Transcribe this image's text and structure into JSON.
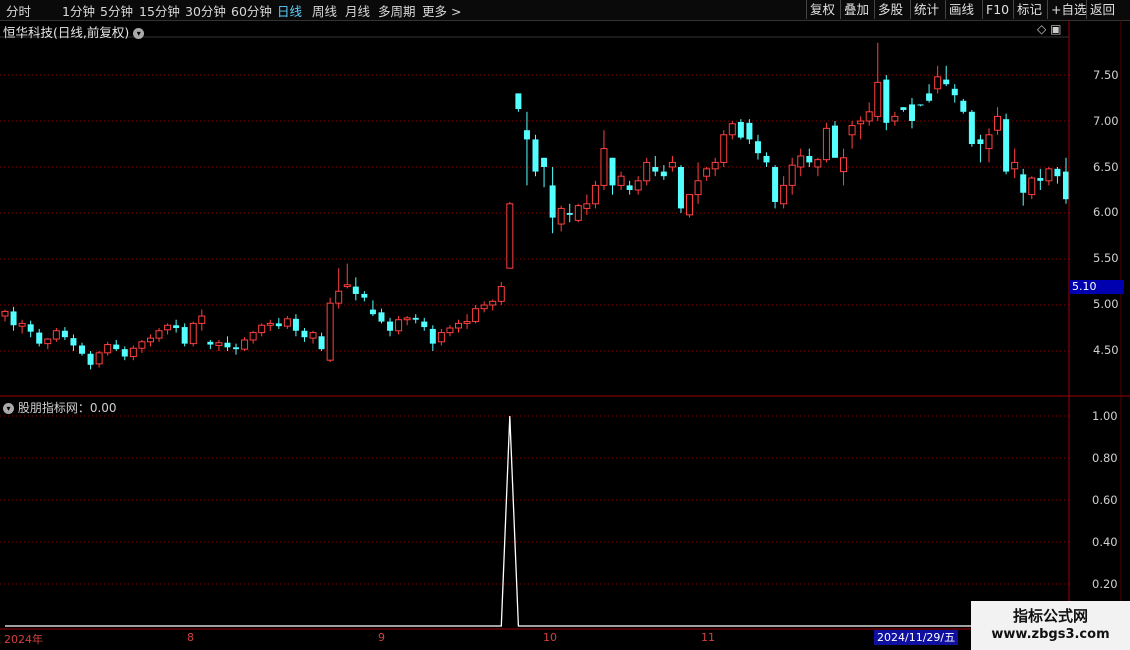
{
  "toolbar": {
    "timeframes": [
      "分时",
      "1分钟",
      "5分钟",
      "15分钟",
      "30分钟",
      "60分钟",
      "日线",
      "周线",
      "月线",
      "多周期",
      "更多 >"
    ],
    "active": "日线",
    "right_buttons": [
      "复权",
      "叠加",
      "多股",
      "统计",
      "画线",
      "F10",
      "标记",
      "+自选",
      "返回"
    ]
  },
  "stock_title": "恒华科技(日线,前复权)",
  "indicator_title": "股朋指标网：0.00",
  "current_price_box": "5.10",
  "price_axis": {
    "labels": [
      "7.50",
      "7.00",
      "6.50",
      "6.00",
      "5.50",
      "5.00",
      "4.50"
    ],
    "min": 4.1,
    "max": 7.95
  },
  "indicator_axis": {
    "labels": [
      "1.00",
      "0.80",
      "0.60",
      "0.40",
      "0.20"
    ]
  },
  "x_axis": {
    "labels": [
      "2024年",
      "8",
      "9",
      "10",
      "11"
    ],
    "cursor_date": "2024/11/29/五"
  },
  "watermark": {
    "line1": "指标公式网",
    "line2": "www.zbgs3.com"
  },
  "colors": {
    "up": "#ff4040",
    "down": "#54ffff",
    "grid": "#8b0000",
    "indicator_line": "#ffffff"
  },
  "chart_data": {
    "type": "candlestick",
    "candles": [
      [
        4.88,
        4.95,
        4.82,
        4.93
      ],
      [
        4.93,
        4.98,
        4.72,
        4.78
      ],
      [
        4.77,
        4.84,
        4.69,
        4.8
      ],
      [
        4.79,
        4.83,
        4.65,
        4.71
      ],
      [
        4.7,
        4.74,
        4.55,
        4.58
      ],
      [
        4.58,
        4.64,
        4.52,
        4.63
      ],
      [
        4.63,
        4.75,
        4.6,
        4.72
      ],
      [
        4.72,
        4.76,
        4.62,
        4.65
      ],
      [
        4.64,
        4.68,
        4.5,
        4.56
      ],
      [
        4.56,
        4.59,
        4.45,
        4.47
      ],
      [
        4.47,
        4.5,
        4.3,
        4.35
      ],
      [
        4.36,
        4.5,
        4.32,
        4.48
      ],
      [
        4.48,
        4.6,
        4.45,
        4.57
      ],
      [
        4.57,
        4.62,
        4.5,
        4.52
      ],
      [
        4.52,
        4.55,
        4.4,
        4.44
      ],
      [
        4.44,
        4.56,
        4.4,
        4.53
      ],
      [
        4.53,
        4.62,
        4.48,
        4.6
      ],
      [
        4.6,
        4.68,
        4.55,
        4.64
      ],
      [
        4.64,
        4.75,
        4.6,
        4.72
      ],
      [
        4.73,
        4.8,
        4.68,
        4.78
      ],
      [
        4.78,
        4.84,
        4.7,
        4.75
      ],
      [
        4.76,
        4.8,
        4.55,
        4.58
      ],
      [
        4.58,
        4.82,
        4.55,
        4.8
      ],
      [
        4.8,
        4.95,
        4.72,
        4.88
      ],
      [
        4.6,
        4.62,
        4.52,
        4.57
      ],
      [
        4.56,
        4.62,
        4.5,
        4.59
      ],
      [
        4.59,
        4.66,
        4.5,
        4.54
      ],
      [
        4.54,
        4.58,
        4.46,
        4.52
      ],
      [
        4.52,
        4.65,
        4.5,
        4.62
      ],
      [
        4.62,
        4.72,
        4.58,
        4.7
      ],
      [
        4.7,
        4.8,
        4.66,
        4.78
      ],
      [
        4.78,
        4.84,
        4.72,
        4.8
      ],
      [
        4.8,
        4.86,
        4.74,
        4.77
      ],
      [
        4.77,
        4.88,
        4.74,
        4.85
      ],
      [
        4.85,
        4.9,
        4.66,
        4.72
      ],
      [
        4.72,
        4.75,
        4.6,
        4.65
      ],
      [
        4.64,
        4.72,
        4.58,
        4.7
      ],
      [
        4.66,
        4.7,
        4.5,
        4.52
      ],
      [
        4.4,
        5.08,
        4.38,
        5.02
      ],
      [
        5.02,
        5.4,
        4.96,
        5.15
      ],
      [
        5.2,
        5.45,
        5.18,
        5.22
      ],
      [
        5.2,
        5.3,
        5.05,
        5.12
      ],
      [
        5.12,
        5.15,
        5.04,
        5.08
      ],
      [
        4.95,
        5.05,
        4.88,
        4.9
      ],
      [
        4.92,
        4.96,
        4.8,
        4.82
      ],
      [
        4.82,
        4.86,
        4.66,
        4.72
      ],
      [
        4.72,
        4.88,
        4.68,
        4.84
      ],
      [
        4.84,
        4.88,
        4.78,
        4.86
      ],
      [
        4.86,
        4.9,
        4.8,
        4.84
      ],
      [
        4.82,
        4.86,
        4.72,
        4.76
      ],
      [
        4.74,
        4.78,
        4.5,
        4.58
      ],
      [
        4.6,
        4.74,
        4.56,
        4.7
      ],
      [
        4.7,
        4.78,
        4.66,
        4.75
      ],
      [
        4.75,
        4.84,
        4.7,
        4.8
      ],
      [
        4.8,
        4.9,
        4.74,
        4.82
      ],
      [
        4.82,
        5.0,
        4.8,
        4.96
      ],
      [
        4.96,
        5.04,
        4.92,
        5.0
      ],
      [
        5.0,
        5.06,
        4.94,
        5.04
      ],
      [
        5.04,
        5.25,
        5.0,
        5.2
      ],
      [
        5.4,
        6.12,
        5.4,
        6.1
      ],
      [
        7.3,
        7.3,
        7.1,
        7.13
      ],
      [
        6.9,
        7.1,
        6.3,
        6.8
      ],
      [
        6.8,
        6.85,
        6.4,
        6.45
      ],
      [
        6.6,
        6.6,
        6.28,
        6.5
      ],
      [
        6.3,
        6.5,
        5.78,
        5.95
      ],
      [
        5.88,
        6.08,
        5.8,
        6.05
      ],
      [
        6.0,
        6.1,
        5.9,
        5.98
      ],
      [
        5.92,
        6.1,
        5.9,
        6.08
      ],
      [
        6.05,
        6.2,
        5.98,
        6.1
      ],
      [
        6.1,
        6.35,
        6.05,
        6.3
      ],
      [
        6.3,
        6.9,
        6.25,
        6.7
      ],
      [
        6.6,
        6.6,
        6.2,
        6.3
      ],
      [
        6.3,
        6.45,
        6.25,
        6.4
      ],
      [
        6.3,
        6.35,
        6.2,
        6.25
      ],
      [
        6.25,
        6.4,
        6.2,
        6.35
      ],
      [
        6.35,
        6.6,
        6.3,
        6.55
      ],
      [
        6.5,
        6.62,
        6.4,
        6.45
      ],
      [
        6.45,
        6.52,
        6.36,
        6.4
      ],
      [
        6.5,
        6.62,
        6.45,
        6.55
      ],
      [
        6.5,
        6.52,
        6.0,
        6.05
      ],
      [
        5.98,
        6.2,
        5.95,
        6.2
      ],
      [
        6.2,
        6.55,
        6.1,
        6.35
      ],
      [
        6.4,
        6.5,
        6.35,
        6.48
      ],
      [
        6.48,
        6.6,
        6.4,
        6.55
      ],
      [
        6.55,
        6.9,
        6.5,
        6.85
      ],
      [
        6.85,
        7.0,
        6.8,
        6.97
      ],
      [
        6.99,
        7.02,
        6.8,
        6.82
      ],
      [
        6.98,
        7.02,
        6.75,
        6.8
      ],
      [
        6.78,
        6.85,
        6.58,
        6.65
      ],
      [
        6.62,
        6.66,
        6.5,
        6.55
      ],
      [
        6.5,
        6.52,
        6.05,
        6.12
      ],
      [
        6.1,
        6.4,
        6.05,
        6.3
      ],
      [
        6.3,
        6.6,
        6.2,
        6.52
      ],
      [
        6.5,
        6.7,
        6.4,
        6.62
      ],
      [
        6.62,
        6.7,
        6.5,
        6.55
      ],
      [
        6.5,
        6.6,
        6.4,
        6.58
      ],
      [
        6.58,
        6.98,
        6.55,
        6.92
      ],
      [
        6.95,
        7.0,
        6.7,
        6.6
      ],
      [
        6.45,
        6.7,
        6.3,
        6.6
      ],
      [
        6.85,
        7.0,
        6.7,
        6.95
      ],
      [
        6.97,
        7.05,
        6.8,
        7.0
      ],
      [
        7.0,
        7.2,
        6.95,
        7.1
      ],
      [
        7.05,
        7.85,
        7.0,
        7.42
      ],
      [
        7.45,
        7.5,
        6.9,
        6.98
      ],
      [
        7.0,
        7.1,
        6.95,
        7.05
      ],
      [
        7.15,
        7.15,
        7.1,
        7.12
      ],
      [
        7.18,
        7.25,
        6.92,
        7.0
      ],
      [
        7.18,
        7.18,
        7.16,
        7.17
      ],
      [
        7.3,
        7.4,
        7.2,
        7.22
      ],
      [
        7.35,
        7.6,
        7.3,
        7.48
      ],
      [
        7.45,
        7.6,
        7.38,
        7.4
      ],
      [
        7.35,
        7.4,
        7.2,
        7.28
      ],
      [
        7.22,
        7.24,
        7.08,
        7.1
      ],
      [
        7.1,
        7.12,
        6.72,
        6.75
      ],
      [
        6.8,
        6.85,
        6.55,
        6.75
      ],
      [
        6.7,
        6.92,
        6.55,
        6.85
      ],
      [
        6.9,
        7.15,
        6.85,
        7.05
      ],
      [
        7.02,
        7.08,
        6.42,
        6.45
      ],
      [
        6.48,
        6.7,
        6.38,
        6.55
      ],
      [
        6.42,
        6.48,
        6.08,
        6.22
      ],
      [
        6.2,
        6.4,
        6.15,
        6.38
      ],
      [
        6.38,
        6.48,
        6.25,
        6.35
      ],
      [
        6.35,
        6.5,
        6.3,
        6.48
      ],
      [
        6.48,
        6.5,
        6.32,
        6.4
      ],
      [
        6.45,
        6.6,
        6.1,
        6.15
      ]
    ],
    "indicator": {
      "peak_index": 59,
      "peak_value": 1.0,
      "baseline": 0.0
    }
  }
}
